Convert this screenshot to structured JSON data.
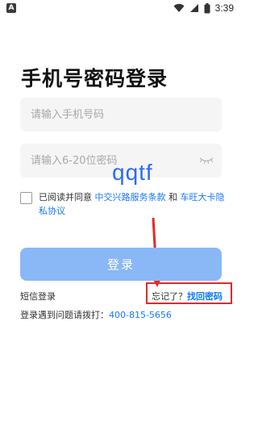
{
  "status_bar": {
    "left_icon": "notification-a-icon",
    "left_icon_letter": "A",
    "icons": [
      "wifi-icon",
      "signal-icon",
      "battery-icon"
    ],
    "time": "3:39"
  },
  "page_title": "手机号密码登录",
  "phone_input": {
    "placeholder": "请输入手机号码",
    "value": ""
  },
  "password_input": {
    "placeholder": "请输入6-20位密码",
    "value": "",
    "toggle_icon": "eye-closed-icon"
  },
  "agreement": {
    "checked": false,
    "prefix": "已阅读并同意 ",
    "link1": "中交兴路服务条款",
    "connector": " 和 ",
    "link2": "车旺大卡隐私协议"
  },
  "watermark": "qqtf",
  "login_button": "登录",
  "sms_login": "短信登录",
  "forgot": {
    "question": "忘记了？",
    "link": "找回密码"
  },
  "help": {
    "text": "登录遇到问题请拨打：",
    "phone": "400-815-5656"
  },
  "colors": {
    "accent": "#1677ff",
    "button": "#8ab8f6",
    "annotation": "#e12a2a"
  }
}
